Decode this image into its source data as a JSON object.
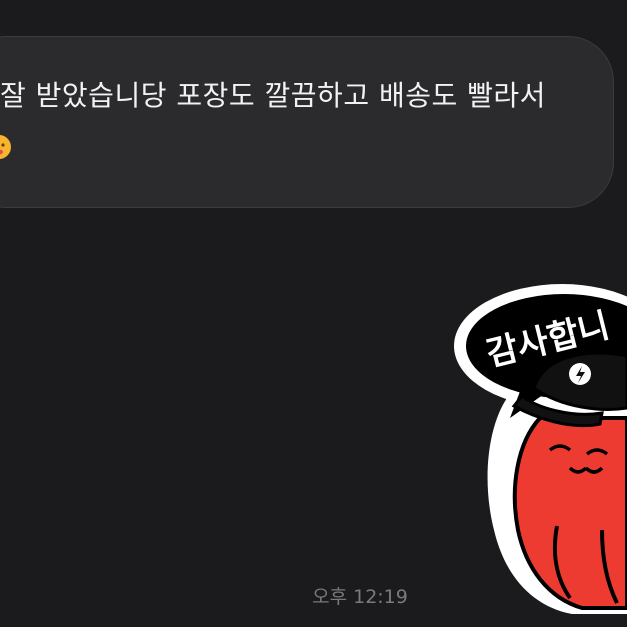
{
  "message": {
    "text": "잘 받았습니당 포장도 깔끔하고 배송도 빨라서",
    "emoji": "face-emoji"
  },
  "sticker": {
    "text": "감사합니",
    "icon": "thank-you-sticker"
  },
  "timestamp": "오후 12:19",
  "colors": {
    "background": "#1b1b1d",
    "bubble": "#2b2b2e",
    "sticker_body": "#ee3b32"
  }
}
